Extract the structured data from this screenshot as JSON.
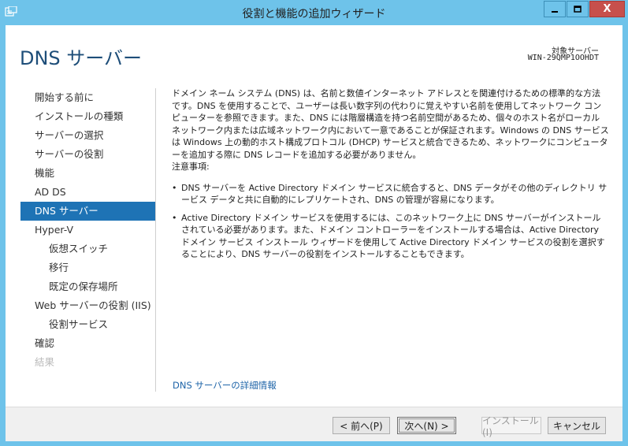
{
  "window": {
    "title": "役割と機能の追加ウィザード",
    "min_icon": "minimize-icon",
    "max_icon": "maximize-icon",
    "close_icon": "close-icon",
    "close_glyph": "X",
    "accent": "#6ec3ea",
    "close_color": "#c7504c"
  },
  "header": {
    "page_title": "DNS サーバー",
    "target_label": "対象サーバー",
    "target_server": "WIN-29QMP1OOHDT"
  },
  "nav": {
    "items": [
      {
        "label": "開始する前に"
      },
      {
        "label": "インストールの種類"
      },
      {
        "label": "サーバーの選択"
      },
      {
        "label": "サーバーの役割"
      },
      {
        "label": "機能"
      },
      {
        "label": "AD DS"
      },
      {
        "label": "DNS サーバー"
      },
      {
        "label": "Hyper-V"
      },
      {
        "label": "仮想スイッチ"
      },
      {
        "label": "移行"
      },
      {
        "label": "既定の保存場所"
      },
      {
        "label": "Web サーバーの役割 (IIS)"
      },
      {
        "label": "役割サービス"
      },
      {
        "label": "確認"
      },
      {
        "label": "結果"
      }
    ],
    "active_color": "#1e73b5"
  },
  "content": {
    "intro": "ドメイン ネーム システム (DNS) は、名前と数値インターネット アドレスとを関連付けるための標準的な方法です。DNS を使用することで、ユーザーは長い数字列の代わりに覚えやすい名前を使用してネットワーク コンピューターを参照できます。また、DNS には階層構造を持つ名前空間があるため、個々のホスト名がローカル ネットワーク内または広域ネットワーク内において一意であることが保証されます。Windows の DNS サービスは Windows 上の動的ホスト構成プロトコル (DHCP) サービスと統合できるため、ネットワークにコンピューターを追加する際に DNS レコードを追加する必要がありません。",
    "caution_title": "注意事項:",
    "bullets": [
      "DNS サーバーを Active Directory ドメイン サービスに統合すると、DNS データがその他のディレクトリ サービス データと共に自動的にレプリケートされ、DNS の管理が容易になります。",
      "Active Directory ドメイン サービスを使用するには、このネットワーク上に DNS サーバーがインストールされている必要があります。また、ドメイン コントローラーをインストールする場合は、Active Directory ドメイン サービス インストール ウィザードを使用して Active Directory ドメイン サービスの役割を選択することにより、DNS サーバーの役割をインストールすることもできます。"
    ],
    "more_link": "DNS サーバーの詳細情報"
  },
  "footer": {
    "prev": "< 前へ(P)",
    "next": "次へ(N) >",
    "install": "インストール(I)",
    "cancel": "キャンセル"
  }
}
